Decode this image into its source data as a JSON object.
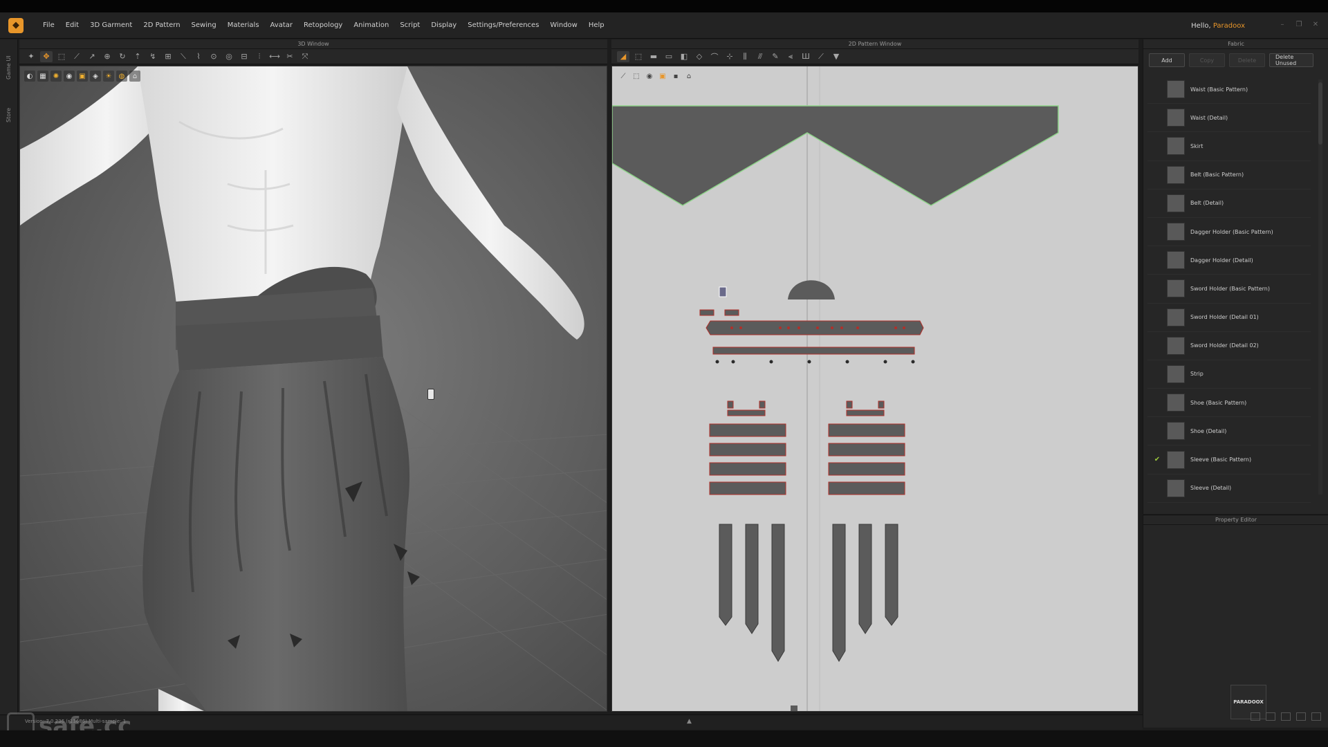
{
  "app": {
    "menu": [
      "File",
      "Edit",
      "3D Garment",
      "2D Pattern",
      "Sewing",
      "Materials",
      "Avatar",
      "Retopology",
      "Animation",
      "Script",
      "Display",
      "Settings/Preferences",
      "Window",
      "Help"
    ],
    "greeting": "Hello,",
    "user": "Paradoox"
  },
  "left_strip": {
    "tabs": [
      "Game UI",
      "Store"
    ]
  },
  "window3d": {
    "title": "3D Window"
  },
  "window2d": {
    "title": "2D Pattern Window"
  },
  "fabric": {
    "title": "Fabric",
    "buttons": {
      "add": "Add",
      "copy": "Copy",
      "delete": "Delete",
      "delete_unused": "Delete Unused"
    },
    "items": [
      {
        "name": "Waist (Basic Pattern)",
        "checked": false
      },
      {
        "name": "Waist (Detail)",
        "checked": false
      },
      {
        "name": "Skirt",
        "checked": false
      },
      {
        "name": "Belt (Basic Pattern)",
        "checked": false
      },
      {
        "name": "Belt (Detail)",
        "checked": false
      },
      {
        "name": "Dagger Holder (Basic Pattern)",
        "checked": false
      },
      {
        "name": "Dagger Holder (Detail)",
        "checked": false
      },
      {
        "name": "Sword Holder (Basic Pattern)",
        "checked": false
      },
      {
        "name": "Sword Holder (Detail 01)",
        "checked": false
      },
      {
        "name": "Sword Holder (Detail 02)",
        "checked": false
      },
      {
        "name": "Strip",
        "checked": false
      },
      {
        "name": "Shoe (Basic Pattern)",
        "checked": false
      },
      {
        "name": "Shoe (Detail)",
        "checked": false
      },
      {
        "name": "Sleeve (Basic Pattern)",
        "checked": true
      },
      {
        "name": "Sleeve (Detail)",
        "checked": false
      }
    ]
  },
  "property_editor": {
    "title": "Property Editor",
    "logo_text": "PARADOOX"
  },
  "status": {
    "text": "Version: 7.0.236 (r13686)    Multi-sample: 1"
  },
  "watermark": {
    "text": "safe.cc"
  },
  "colors": {
    "accent": "#e8962a",
    "pattern_fill": "#5b5b5b",
    "pattern_outline_selected": "#8fd48a",
    "stitch": "#b0302a"
  }
}
